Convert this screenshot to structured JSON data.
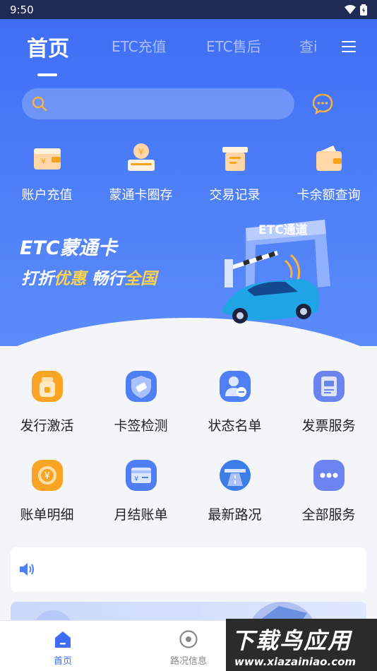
{
  "status_bar": {
    "time": "9:50"
  },
  "header": {
    "tabs": [
      {
        "label": "首页",
        "active": true
      },
      {
        "label": "ETC充值",
        "active": false
      },
      {
        "label": "ETC售后",
        "active": false
      },
      {
        "label": "查i",
        "active": false
      }
    ],
    "menu_icon": "hamburger-menu-icon"
  },
  "search": {
    "placeholder": "",
    "value": "",
    "icon": "search-icon"
  },
  "chat_icon": "chat-bubble-icon",
  "quick_actions": [
    {
      "label": "账户充值",
      "icon": "wallet-recharge-icon"
    },
    {
      "label": "蒙通卡圈存",
      "icon": "card-deposit-icon"
    },
    {
      "label": "交易记录",
      "icon": "transaction-record-icon"
    },
    {
      "label": "卡余额查询",
      "icon": "card-balance-icon"
    }
  ],
  "banner": {
    "title": "ETC蒙通卡",
    "sub_a": "打折",
    "sub_b": "优惠",
    "sub_c": "畅行",
    "sub_d": "全国",
    "gate_label": "ETC通道"
  },
  "services": [
    {
      "label": "发行激活",
      "icon": "activation-icon",
      "color": "#f7a21b"
    },
    {
      "label": "卡签检测",
      "icon": "card-detect-icon",
      "color": "#4a7cf7"
    },
    {
      "label": "状态名单",
      "icon": "status-list-icon",
      "color": "#4a7cf7"
    },
    {
      "label": "发票服务",
      "icon": "invoice-icon",
      "color": "#5b7cf2"
    },
    {
      "label": "账单明细",
      "icon": "bill-detail-icon",
      "color": "#f7a21b"
    },
    {
      "label": "月结账单",
      "icon": "monthly-bill-icon",
      "color": "#4a7cf7"
    },
    {
      "label": "最新路况",
      "icon": "road-condition-icon",
      "color": "#3c7de8"
    },
    {
      "label": "全部服务",
      "icon": "all-services-icon",
      "color": "#5b7cf2"
    }
  ],
  "notice": {
    "icon": "speaker-icon",
    "text": ""
  },
  "bottom_nav": [
    {
      "label": "首页",
      "icon": "home-icon",
      "active": true
    },
    {
      "label": "路况信息",
      "icon": "road-info-icon",
      "active": false
    }
  ],
  "watermark": {
    "main": "下载鸟应用",
    "url": "www.xiazainiao.com"
  },
  "colors": {
    "primary": "#3f6cf4",
    "accent_orange": "#f7a21b",
    "highlight_yellow": "#ffd34e"
  }
}
